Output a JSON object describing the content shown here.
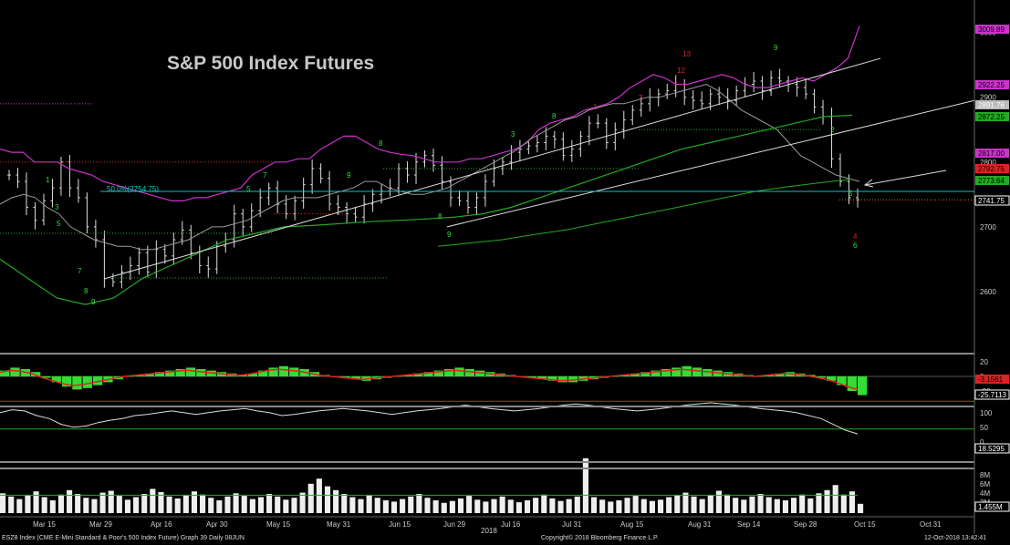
{
  "title": "S&P 500 Index Futures",
  "fib_label": "50.0%(2754.75)",
  "colors": {
    "background": "#000000",
    "price_bar": "#dddddd",
    "up_count": "#33dd33",
    "down_count": "#dd2222",
    "bollinger": "#cc33cc",
    "ma_short": "#9a9a9a",
    "ma_long": "#22aa22",
    "trendline": "#dddddd",
    "fib_line": "#22bbbb",
    "rsi_line": "#dddddd",
    "rsi_upper": "#dd2222",
    "rsi_lower": "#22aa22"
  },
  "chart_data": {
    "type": "line",
    "x_tick_labels": [
      "Mar 15",
      "Mar 29",
      "Apr 16",
      "Apr 30",
      "May 15",
      "May 31",
      "Jun 15",
      "Jun 29",
      "Jul 16",
      "Jul 31",
      "Aug 15",
      "Aug 31",
      "Sep 14",
      "Sep 28",
      "Oct 15",
      "Oct 31"
    ],
    "x_year_label": "2018",
    "price_axis": {
      "ticks": [
        2600,
        2700,
        2800,
        2900,
        3000
      ],
      "markers": [
        {
          "label": "3009.89",
          "color": "#cc33cc"
        },
        {
          "label": "2922.25",
          "color": "#cc33cc"
        },
        {
          "label": "2891.76",
          "color": "#bbbbbb"
        },
        {
          "label": "2872.25",
          "color": "#22aa22"
        },
        {
          "label": "2817.00",
          "color": "#cc33cc"
        },
        {
          "label": "2792.75",
          "color": "#dd2222"
        },
        {
          "label": "2773.64",
          "color": "#22aa22"
        },
        {
          "label": "2741.75",
          "color": "#ffffff"
        }
      ]
    },
    "price_close": [
      2780,
      2770,
      2730,
      2710,
      2740,
      2760,
      2800,
      2760,
      2745,
      2700,
      2680,
      2620,
      2615,
      2630,
      2640,
      2660,
      2630,
      2665,
      2655,
      2680,
      2695,
      2660,
      2640,
      2635,
      2670,
      2680,
      2720,
      2700,
      2725,
      2745,
      2760,
      2735,
      2720,
      2740,
      2765,
      2790,
      2775,
      2735,
      2730,
      2720,
      2715,
      2735,
      2750,
      2755,
      2760,
      2790,
      2780,
      2800,
      2810,
      2795,
      2770,
      2745,
      2740,
      2730,
      2745,
      2770,
      2790,
      2800,
      2815,
      2820,
      2825,
      2830,
      2840,
      2835,
      2810,
      2820,
      2840,
      2860,
      2860,
      2830,
      2850,
      2865,
      2880,
      2890,
      2900,
      2905,
      2910,
      2920,
      2900,
      2895,
      2890,
      2905,
      2900,
      2895,
      2910,
      2920,
      2925,
      2910,
      2930,
      2925,
      2920,
      2915,
      2905,
      2885,
      2870,
      2805,
      2770,
      2745,
      2741.75
    ],
    "bollinger_upper": [
      2820,
      2815,
      2815,
      2800,
      2800,
      2800,
      2790,
      2785,
      2780,
      2770,
      2765,
      2760,
      2755,
      2750,
      2745,
      2740,
      2740,
      2745,
      2745,
      2750,
      2755,
      2760,
      2780,
      2790,
      2800,
      2800,
      2805,
      2805,
      2820,
      2830,
      2840,
      2840,
      2830,
      2820,
      2815,
      2812,
      2810,
      2805,
      2800,
      2800,
      2800,
      2805,
      2805,
      2810,
      2815,
      2820,
      2830,
      2850,
      2860,
      2865,
      2870,
      2880,
      2885,
      2890,
      2900,
      2915,
      2925,
      2935,
      2930,
      2920,
      2920,
      2925,
      2930,
      2935,
      2930,
      2920,
      2915,
      2915,
      2920,
      2925,
      2930,
      2925,
      2935,
      2945,
      2960,
      3009.89
    ],
    "ma_short": [
      2735,
      2745,
      2750,
      2745,
      2730,
      2720,
      2700,
      2690,
      2680,
      2675,
      2670,
      2670,
      2665,
      2665,
      2670,
      2675,
      2680,
      2690,
      2700,
      2700,
      2705,
      2710,
      2720,
      2730,
      2740,
      2745,
      2745,
      2745,
      2750,
      2755,
      2760,
      2770,
      2770,
      2760,
      2755,
      2750,
      2750,
      2755,
      2760,
      2770,
      2780,
      2790,
      2800,
      2810,
      2820,
      2835,
      2845,
      2855,
      2865,
      2870,
      2880,
      2885,
      2890,
      2890,
      2895,
      2900,
      2900,
      2905,
      2910,
      2915,
      2920,
      2910,
      2895,
      2880,
      2870,
      2860,
      2850,
      2830,
      2810,
      2800,
      2790,
      2780,
      2775,
      2770
    ],
    "ma_long": [
      2650,
      2620,
      2590,
      2580,
      2590,
      2620,
      2640,
      2660,
      2680,
      2690,
      2700,
      2702,
      2705,
      2708,
      2710,
      2712,
      2715,
      2720,
      2730,
      2745,
      2760,
      2775,
      2790,
      2805,
      2820,
      2830,
      2840,
      2850,
      2860,
      2870,
      2872.25
    ],
    "ma_200": [
      2670,
      2675,
      2680,
      2688,
      2695,
      2705,
      2715,
      2725,
      2735,
      2745,
      2755,
      2762,
      2768,
      2773.64
    ],
    "fib_level": 2754.75,
    "dotted_levels": [
      2690,
      2621,
      2800,
      2850,
      2790,
      2870
    ],
    "annotations_arrow": "points to 2741.75 close",
    "macd_panel": {
      "ticks": [
        "20",
        "0",
        "-20"
      ],
      "markers": [
        {
          "label": "-3.1561",
          "color": "#dd2222"
        },
        {
          "label": "-25.7113",
          "color": "#ffffff"
        }
      ],
      "histogram": [
        8,
        12,
        10,
        6,
        -2,
        -8,
        -14,
        -18,
        -16,
        -12,
        -8,
        -4,
        0,
        2,
        4,
        6,
        8,
        10,
        12,
        10,
        8,
        6,
        4,
        2,
        4,
        8,
        12,
        14,
        12,
        10,
        6,
        2,
        0,
        -2,
        -4,
        -6,
        -4,
        -2,
        0,
        2,
        4,
        6,
        8,
        10,
        12,
        10,
        8,
        6,
        4,
        2,
        0,
        -2,
        -4,
        -6,
        -8,
        -8,
        -6,
        -4,
        -2,
        0,
        2,
        4,
        6,
        8,
        10,
        12,
        14,
        12,
        10,
        8,
        6,
        4,
        2,
        0,
        2,
        4,
        6,
        4,
        2,
        -2,
        -6,
        -12,
        -20,
        -25.7
      ]
    },
    "rsi_panel": {
      "ticks": [
        "100",
        "50",
        "0"
      ],
      "marker": {
        "label": "18.5295",
        "color": "#ffffff"
      },
      "upper_level": 70,
      "lower_level": 30,
      "values": [
        55,
        60,
        58,
        50,
        45,
        35,
        30,
        32,
        38,
        42,
        45,
        50,
        52,
        55,
        58,
        55,
        52,
        55,
        58,
        60,
        62,
        58,
        55,
        50,
        52,
        55,
        58,
        60,
        62,
        60,
        58,
        55,
        52,
        55,
        58,
        60,
        62,
        65,
        68,
        65,
        62,
        60,
        58,
        60,
        62,
        65,
        68,
        70,
        68,
        65,
        62,
        60,
        58,
        60,
        62,
        65,
        68,
        70,
        72,
        70,
        68,
        65,
        62,
        60,
        58,
        55,
        50,
        45,
        35,
        25,
        18.5295
      ]
    },
    "volume_panel": {
      "ticks": [
        "8M",
        "6M",
        "4M",
        "2M"
      ],
      "marker": {
        "label": "1.455M",
        "color": "#ffffff"
      },
      "values_millions": [
        3.1,
        2.6,
        2.2,
        2.8,
        3.4,
        2.5,
        2.0,
        2.9,
        3.6,
        3.0,
        2.4,
        2.2,
        3.2,
        3.5,
        2.7,
        2.1,
        2.5,
        3.0,
        3.8,
        3.3,
        2.6,
        2.3,
        2.8,
        3.4,
        2.9,
        2.4,
        2.0,
        2.6,
        3.1,
        2.7,
        2.2,
        2.5,
        3.0,
        2.6,
        2.1,
        2.4,
        3.2,
        4.6,
        5.4,
        4.2,
        3.6,
        3.0,
        2.5,
        2.2,
        2.8,
        2.4,
        2.0,
        1.8,
        2.2,
        2.6,
        3.0,
        2.4,
        2.0,
        1.6,
        1.9,
        2.3,
        2.7,
        2.1,
        1.8,
        2.2,
        2.6,
        2.1,
        1.7,
        2.0,
        2.4,
        2.9,
        2.3,
        1.9,
        2.2,
        2.6,
        8.6,
        2.5,
        2.1,
        1.8,
        2.0,
        2.4,
        2.7,
        2.2,
        1.9,
        2.1,
        2.5,
        2.8,
        3.2,
        2.6,
        2.2,
        2.8,
        3.5,
        2.9,
        2.4,
        2.1,
        2.6,
        3.0,
        2.5,
        2.2,
        2.0,
        2.4,
        2.9,
        2.3,
        3.1,
        3.6,
        4.4,
        2.9,
        3.4,
        1.455
      ]
    }
  },
  "footer": {
    "left": "ESZ8 Index (CME E-Mini Standard & Poor's 500 Index Future) Graph 39  Daily 08JUN",
    "center": "Copyright© 2018 Bloomberg Finance L.P.",
    "right": "12-Oct-2018 13:42:41"
  }
}
